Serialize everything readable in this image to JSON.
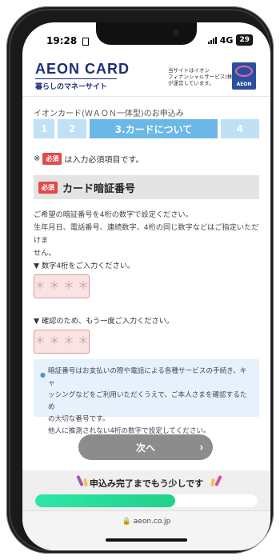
{
  "status": {
    "time": "19:28",
    "network": "4G",
    "battery": "29"
  },
  "header": {
    "logo_main": "AEON CARD",
    "logo_sub": "暮らしのマネーサイト",
    "note_line1": "当サイトはイオン",
    "note_line2": "フィナンシャルサービス(株)",
    "note_line3": "が運営しています。",
    "emblem_text": "AEON"
  },
  "breadcrumb": "イオンカード(ＷＡＯＮ一体型)のお申込み",
  "steps": [
    {
      "label": "1"
    },
    {
      "label": "2"
    },
    {
      "label": "3.カードについて"
    },
    {
      "label": "4"
    }
  ],
  "required_note": {
    "mark": "※",
    "badge": "必須",
    "text": "は入力必須項目です。"
  },
  "section": {
    "badge": "必須",
    "title": "カード暗証番号"
  },
  "description": {
    "line1": "ご希望の暗証番号を4桁の数字で設定ください。",
    "line2": "生年月日、電話番号、連続数字、4桁の同じ数字などはご指定いただけま",
    "line3": "せん。"
  },
  "pin_field": {
    "label": "▼ 数字4桁をご入力ください。",
    "placeholder": "＊＊＊＊"
  },
  "confirm_field": {
    "label": "▼ 確認のため、もう一度ご入力ください。",
    "placeholder": "＊＊＊＊"
  },
  "info": {
    "line1": "暗証番号はお支払いの際や電話による各種サービスの手続き、キャ",
    "line2": "ッシングなどをご利用いただくうえで、ご本人さまを確認するため",
    "line3": "の大切な番号です。",
    "line4": "他人に推測されない4桁の数字で設定してください。"
  },
  "next_button": {
    "label": "次へ",
    "chevron": "›"
  },
  "progress": {
    "label": "申込み完了までもう少しです",
    "fraction": 0.63
  },
  "url": "aeon.co.jp",
  "colors": {
    "brand": "#1e2e78",
    "step_active": "#6bb7e8",
    "step_inactive": "#bfe0f5",
    "required": "#e04b4b",
    "progress_fill": "#2ee6a8",
    "button": "#8c8c8c"
  }
}
